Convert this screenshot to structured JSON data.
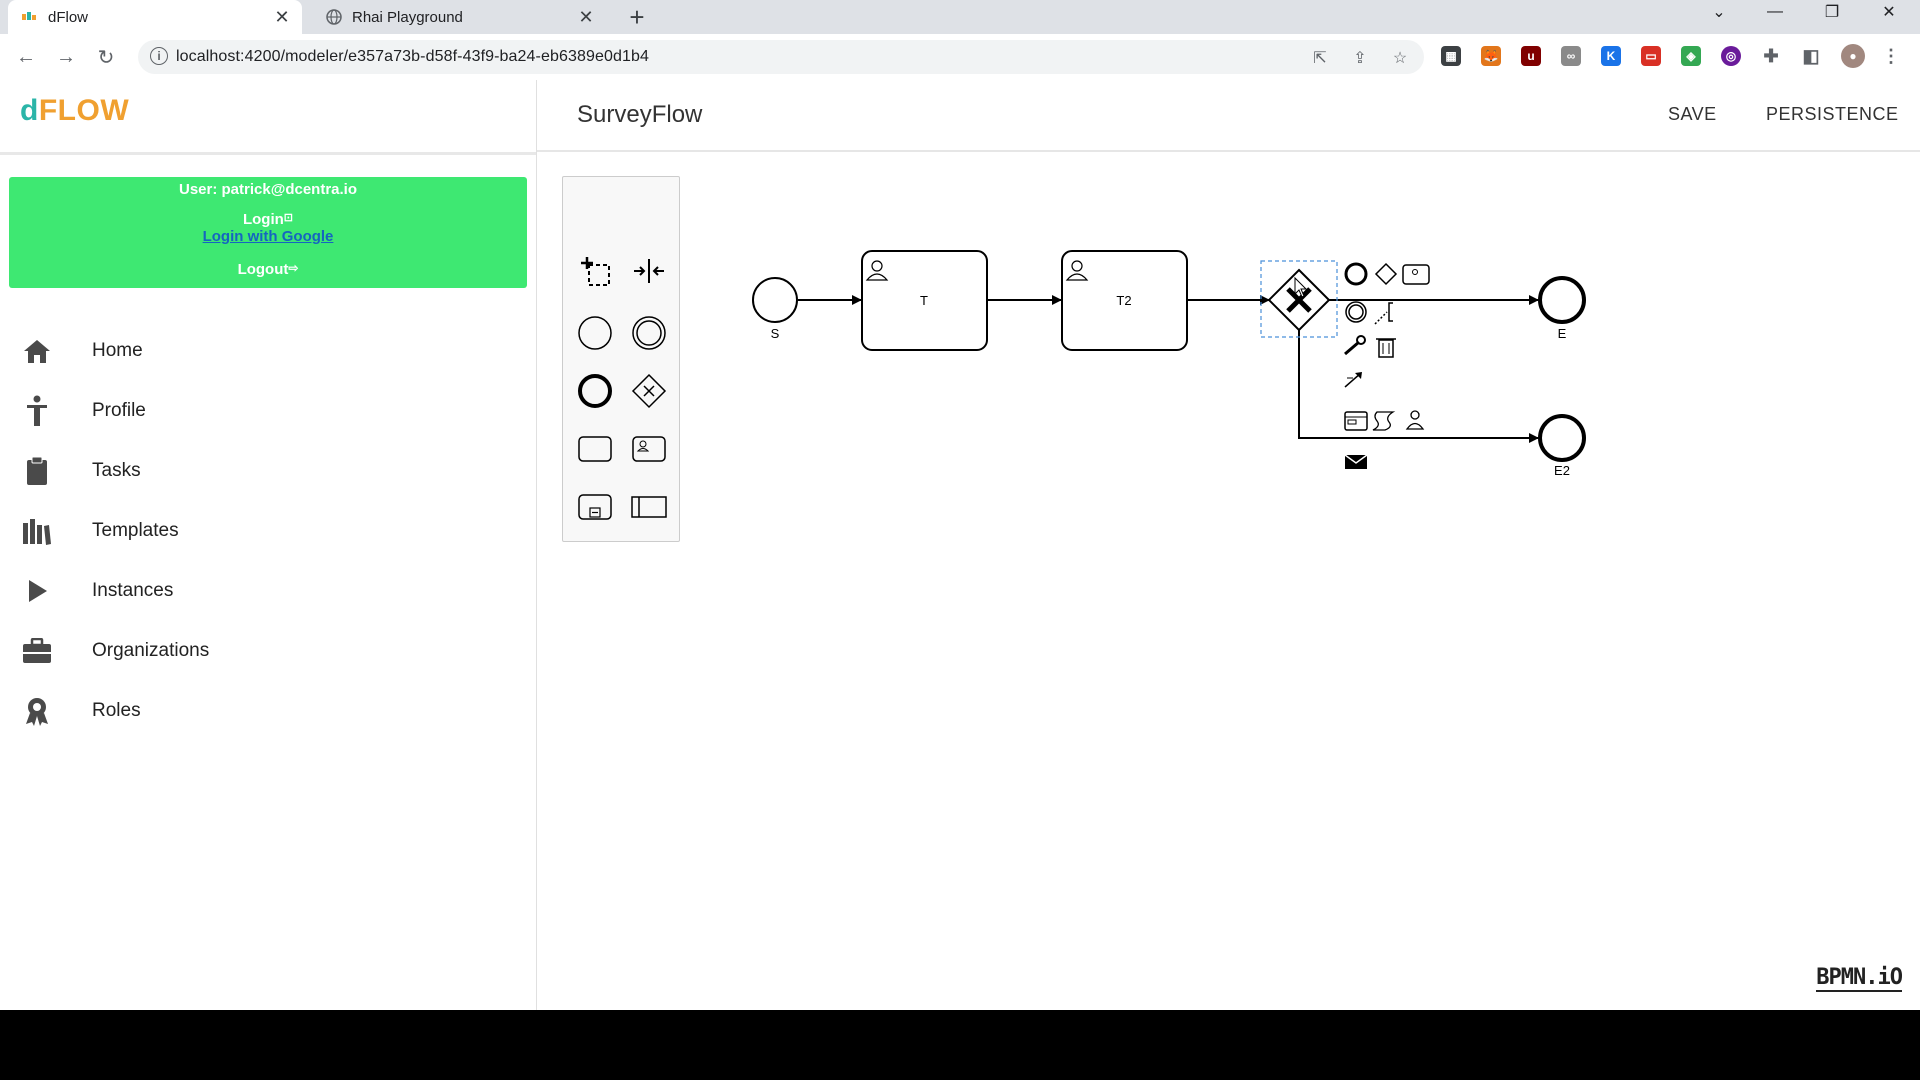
{
  "browser": {
    "tabs": [
      {
        "title": "dFlow",
        "icon": "dflow-favicon-icon",
        "active": true
      },
      {
        "title": "Rhai Playground",
        "icon": "globe-icon",
        "active": false
      }
    ],
    "url": "localhost:4200/modeler/e357a73b-d58f-43f9-ba24-eb6389e0d1b4"
  },
  "app": {
    "logo": {
      "part1": "d",
      "part2": "FLOW"
    },
    "user": {
      "label": "User: patrick@dcentra.io",
      "login": "Login",
      "login_google": "Login with Google",
      "logout": "Logout"
    },
    "nav": [
      {
        "label": "Home",
        "icon": "home-icon"
      },
      {
        "label": "Profile",
        "icon": "person-icon"
      },
      {
        "label": "Tasks",
        "icon": "clipboard-icon"
      },
      {
        "label": "Templates",
        "icon": "library-icon"
      },
      {
        "label": "Instances",
        "icon": "play-icon"
      },
      {
        "label": "Organizations",
        "icon": "briefcase-icon"
      },
      {
        "label": "Roles",
        "icon": "award-icon"
      }
    ],
    "header": {
      "title": "SurveyFlow",
      "save": "SAVE",
      "persistence": "PERSISTENCE"
    }
  },
  "diagram": {
    "elements": [
      {
        "id": "S",
        "type": "start-event",
        "label": "S"
      },
      {
        "id": "T",
        "type": "user-task",
        "label": "T"
      },
      {
        "id": "T2",
        "type": "user-task",
        "label": "T2"
      },
      {
        "id": "G",
        "type": "exclusive-gateway",
        "label": "",
        "selected": true
      },
      {
        "id": "E",
        "type": "end-event",
        "label": "E"
      },
      {
        "id": "E2",
        "type": "end-event",
        "label": "E2"
      }
    ],
    "flows": [
      [
        "S",
        "T"
      ],
      [
        "T",
        "T2"
      ],
      [
        "T2",
        "G"
      ],
      [
        "G",
        "E"
      ],
      [
        "G",
        "E2"
      ]
    ]
  },
  "watermark": "BPMN.iO"
}
